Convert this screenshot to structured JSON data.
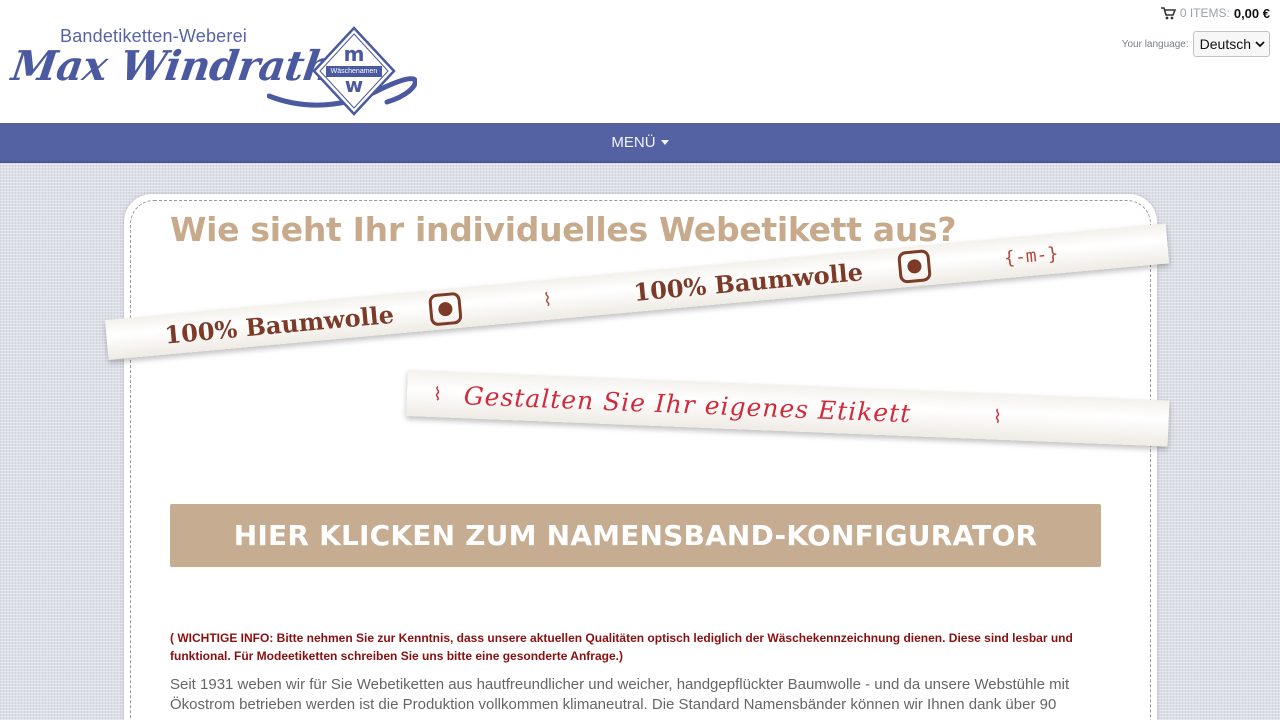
{
  "header": {
    "tagline": "Bandetiketten-Weberei",
    "brand": "Max Windrath",
    "badge": "Wäschenamen",
    "cart": {
      "items_label": "0 ITEMS:",
      "total": "0,00 €"
    },
    "language": {
      "label": "Your language:",
      "selected": "Deutsch"
    }
  },
  "nav": {
    "menu_label": "MENÜ"
  },
  "main": {
    "title": "Wie sieht Ihr individuelles Webetikett aus?",
    "ribbons": {
      "cotton_text_1": "100% Baumwolle",
      "cotton_text_2": "100% Baumwolle",
      "custom_text": "Gestalten Sie Ihr eigenes Etikett"
    },
    "cta_label": "HIER KLICKEN ZUM NAMENSBAND-KONFIGURATOR",
    "notice": "( WICHTIGE INFO: Bitte nehmen Sie zur Kenntnis, dass unsere aktuellen Qualitäten optisch lediglich der Wäschekennzeichnung dienen. Diese sind lesbar und funktional. Für Modeetiketten schreiben Sie uns bitte eine gesonderte Anfrage.)",
    "body": "Seit 1931 weben wir für Sie Webetiketten aus hautfreundlicher und weicher, handgepflückter Baumwolle - und da unsere Webstühle mit Ökostrom betrieben werden ist die Produktion vollkommen klimaneutral. Die Standard Namensbänder können wir Ihnen dank über 90"
  },
  "colors": {
    "brand_blue": "#4b5aa0",
    "nav_blue": "#5462a4",
    "accent_beige": "#c6ad92",
    "title_beige": "#c7aa8b",
    "notice_red": "#8a0f0f"
  }
}
